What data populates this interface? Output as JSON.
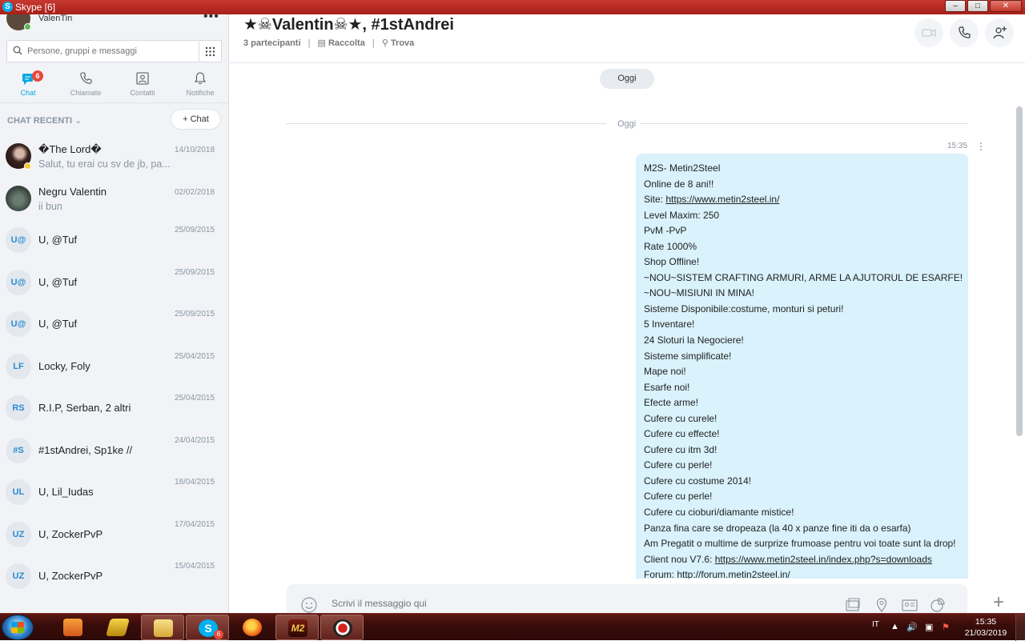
{
  "window": {
    "title": "Skype [6]",
    "logo": "S"
  },
  "profile": {
    "name": "ValenTin"
  },
  "search": {
    "placeholder": "Persone, gruppi e messaggi"
  },
  "nav": {
    "tabs": [
      {
        "label": "Chat",
        "badge": "6"
      },
      {
        "label": "Chiamate"
      },
      {
        "label": "Contatti"
      },
      {
        "label": "Notifiche"
      }
    ]
  },
  "recent": {
    "header": "CHAT RECENTI",
    "new_chat_label": "Chat"
  },
  "chats": [
    {
      "name": "�The Lord�",
      "preview": "Salut, tu erai cu sv de jb, pa...",
      "date": "14/10/2018"
    },
    {
      "name": "Negru Valentin",
      "preview": "ii bun",
      "date": "02/02/2018"
    },
    {
      "initials": "U@",
      "name": "U, @Tuf",
      "date": "25/09/2015"
    },
    {
      "initials": "U@",
      "name": "U, @Tuf",
      "date": "25/09/2015"
    },
    {
      "initials": "U@",
      "name": "U, @Tuf",
      "date": "25/09/2015"
    },
    {
      "initials": "LF",
      "name": "Locky, Foly",
      "date": "25/04/2015"
    },
    {
      "initials": "RS",
      "name": "R.I.P, Serban, 2 altri",
      "date": "25/04/2015"
    },
    {
      "initials": "#S",
      "name": "#1stAndrei, Sp1ke //",
      "date": "24/04/2015"
    },
    {
      "initials": "UL",
      "name": "U, Lil_Iudas",
      "date": "18/04/2015"
    },
    {
      "initials": "UZ",
      "name": "U, ZockerPvP",
      "date": "17/04/2015"
    },
    {
      "initials": "UZ",
      "name": "U, ZockerPvP",
      "date": "15/04/2015"
    }
  ],
  "conversation": {
    "title": "★☠Valentin☠★, #1stAndrei",
    "participants": "3 partecipanti",
    "gallery": "Raccolta",
    "find": "Trova",
    "date_pill": "Oggi",
    "day_separator": "Oggi",
    "message_time": "15:35",
    "message_lines": [
      "M2S- Metin2Steel",
      "Online de 8 ani!!",
      "Site: ",
      "Level Maxim: 250",
      "PvM -PvP",
      "Rate 1000%",
      "Shop Offline!",
      "~NOU~SISTEM CRAFTING ARMURI, ARME LA AJUTORUL DE ESARFE!",
      "~NOU~MISIUNI IN MINA!",
      "Sisteme Disponibile:costume, monturi si peturi!",
      "5 Inventare!",
      "24 Sloturi la Negociere!",
      "Sisteme simplificate!",
      "Mape noi!",
      "Esarfe noi!",
      "Efecte arme!",
      "Cufere cu curele!",
      "Cufere cu effecte!",
      "Cufere cu itm 3d!",
      "Cufere cu perle!",
      "Cufere cu costume 2014!",
      "Cufere cu perle!",
      "Cufere cu cioburi/diamante mistice!",
      "Panza fina care se dropeaza (la 40 x panze fine iti da o esarfa)",
      "Am Pregatit o multime de surprize frumoase pentru voi toate sunt la drop!",
      "Client nou V7.6: ",
      "Forum: http://forum.metin2steel.in/"
    ],
    "site_link": "https://www.metin2steel.in/",
    "client_link": "https://www.metin2steel.in/index.php?s=downloads"
  },
  "compose": {
    "placeholder": "Scrivi il messaggio qui"
  },
  "taskbar": {
    "lang": "IT",
    "time": "15:35",
    "date": "21/03/2019",
    "skype_badge": "6"
  }
}
